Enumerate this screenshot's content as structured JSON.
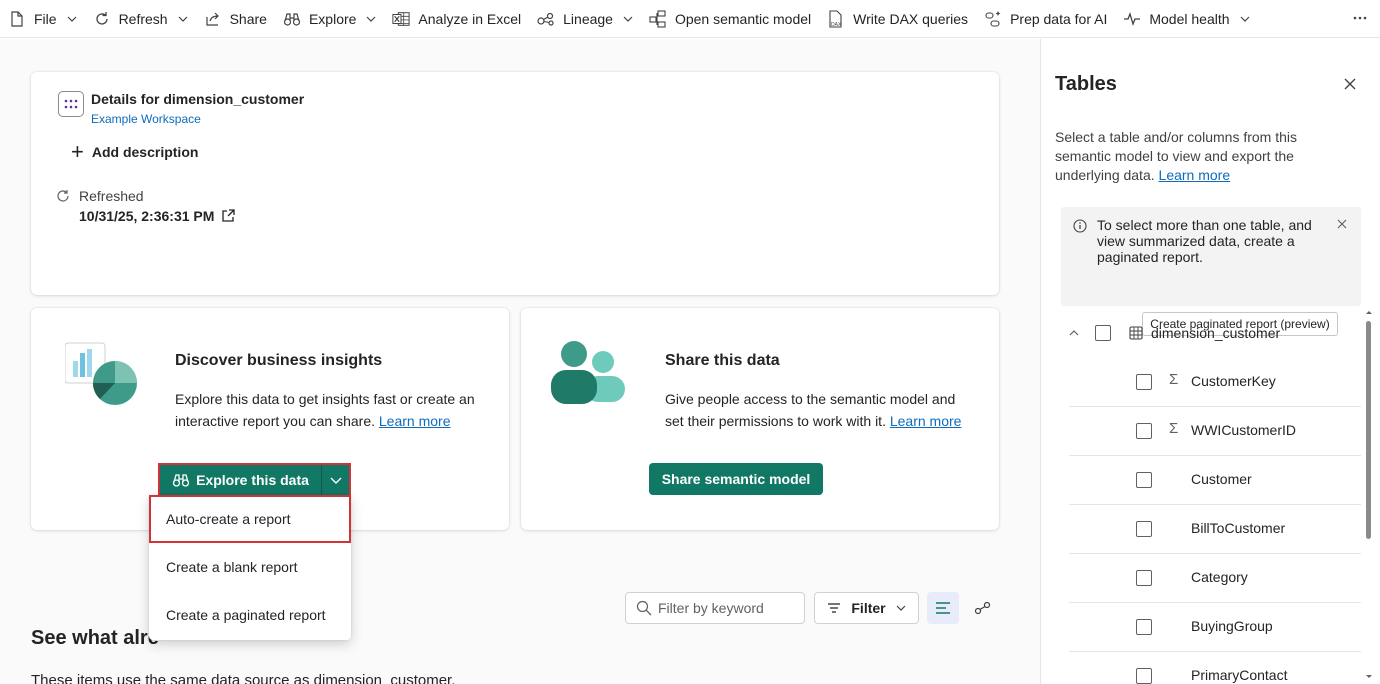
{
  "toolbar": {
    "file": "File",
    "refresh": "Refresh",
    "share": "Share",
    "explore": "Explore",
    "analyze": "Analyze in Excel",
    "lineage": "Lineage",
    "open_model": "Open semantic model",
    "write_dax": "Write DAX queries",
    "prep_ai": "Prep data for AI",
    "model_health": "Model health"
  },
  "details": {
    "title": "Details for dimension_customer",
    "workspace": "Example Workspace",
    "add_description": "Add description",
    "refreshed_label": "Refreshed",
    "refreshed_time": "10/31/25, 2:36:31 PM"
  },
  "insights": {
    "title": "Discover business insights",
    "text": "Explore this data to get insights fast or create an interactive report you can share.",
    "link": "Learn more",
    "button": "Explore this data"
  },
  "share": {
    "title": "Share this data",
    "text": "Give people access to the semantic model and set their permissions to work with it.",
    "link": "Learn more",
    "button": "Share semantic model"
  },
  "menu": {
    "items": [
      "Auto-create a report",
      "Create a blank report",
      "Create a paginated report"
    ]
  },
  "related": {
    "title": "See what alre",
    "subtitle": "These items use the same data source as dimension_customer.",
    "filter_placeholder": "Filter by keyword",
    "filter_button": "Filter"
  },
  "panel": {
    "title": "Tables",
    "description": "Select a table and/or columns from this semantic model to view and export the underlying data.",
    "learn_more": "Learn more",
    "info_text": "To select more than one table, and view summarized data, create a paginated report.",
    "info_button": "Create paginated report (preview)",
    "table_name": "dimension_customer",
    "columns": [
      {
        "name": "CustomerKey",
        "sigma": "Σ"
      },
      {
        "name": "WWICustomerID",
        "sigma": "Σ"
      },
      {
        "name": "Customer",
        "sigma": ""
      },
      {
        "name": "BillToCustomer",
        "sigma": ""
      },
      {
        "name": "Category",
        "sigma": ""
      },
      {
        "name": "BuyingGroup",
        "sigma": ""
      },
      {
        "name": "PrimaryContact",
        "sigma": ""
      }
    ]
  },
  "colors": {
    "accent": "#117865",
    "highlight": "#d13438",
    "link": "#0f6cbd"
  }
}
